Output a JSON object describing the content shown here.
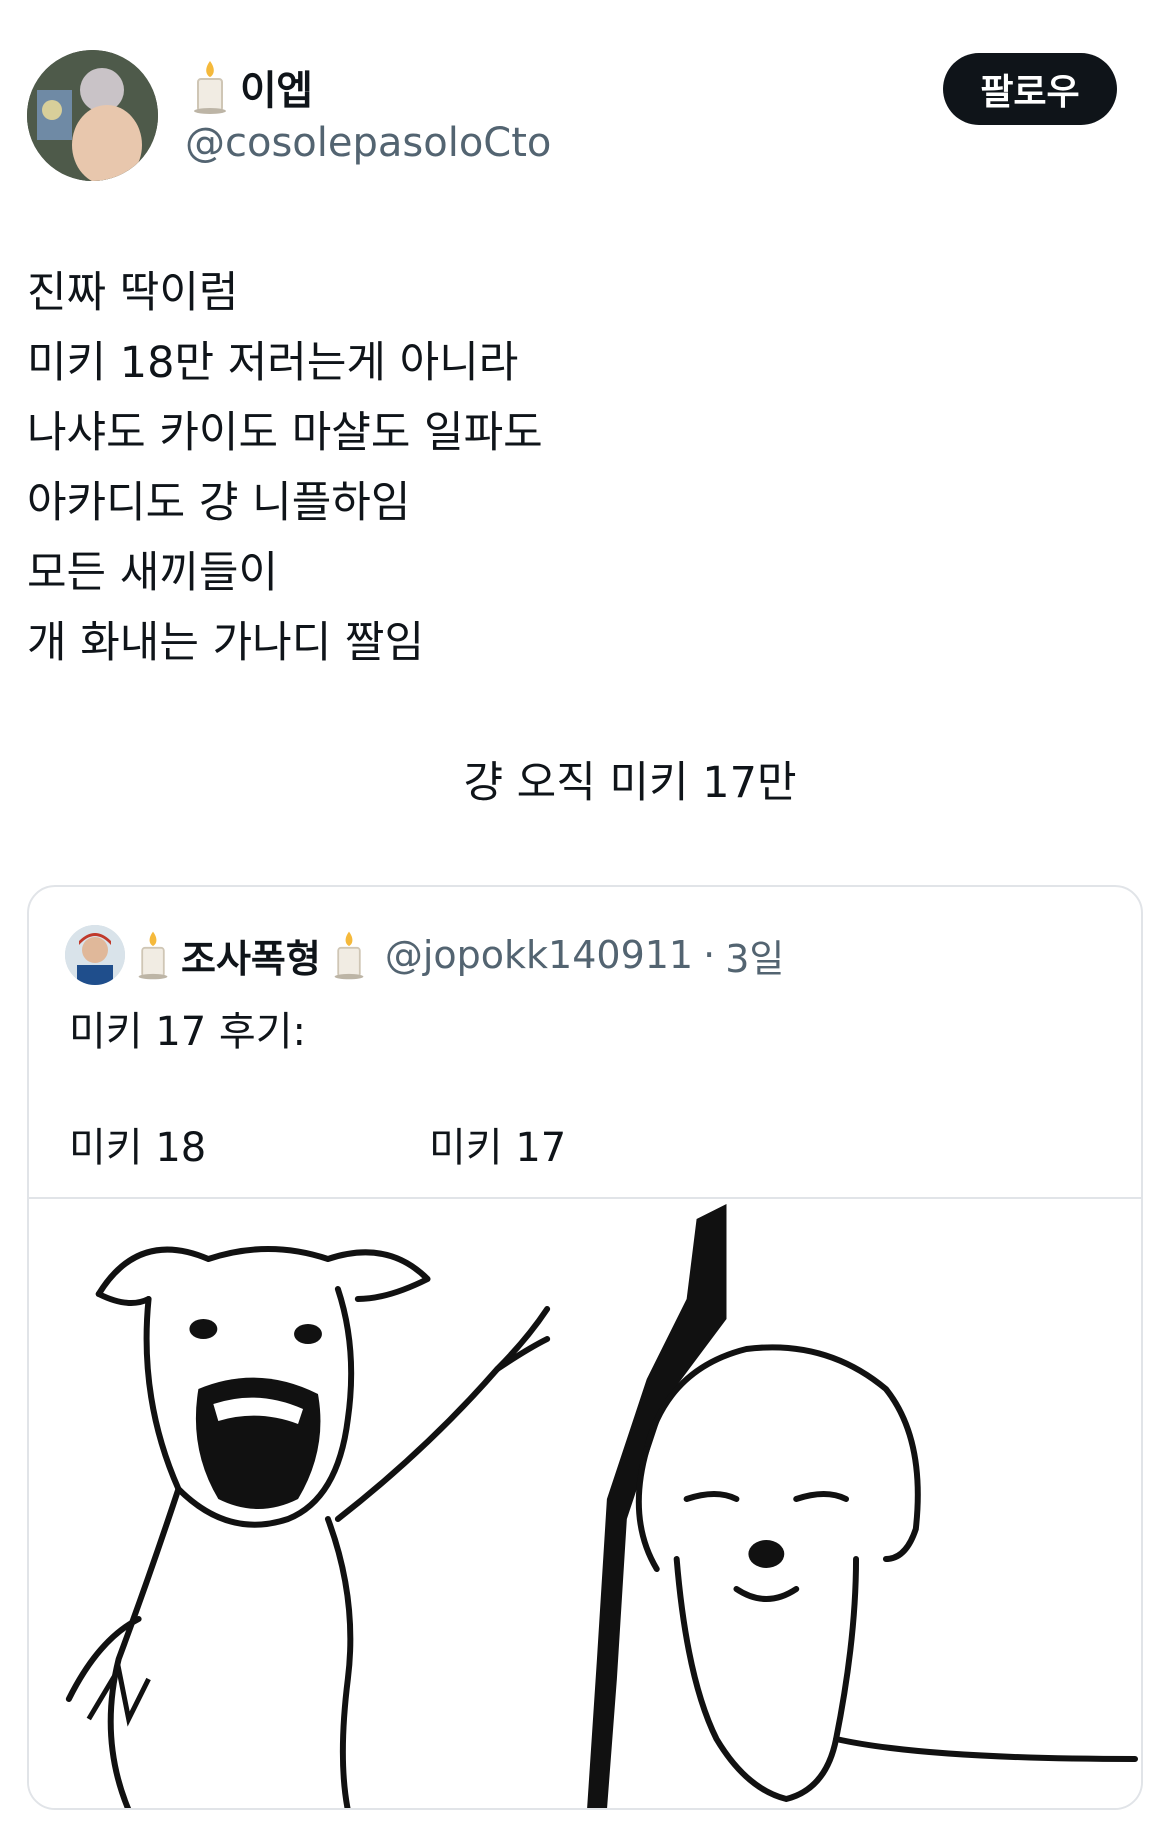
{
  "author": {
    "display_name": "이엡",
    "name_emoji_icon": "candle-icon",
    "handle": "@cosolepasoloCto",
    "follow_label": "팔로우"
  },
  "tweet": {
    "lines": [
      "진짜 딱이럼",
      "미키 18만 저러는게 아니라",
      "나샤도 카이도 마샬도 일파도",
      "아카디도 걍 니플하임",
      "모든 새끼들이",
      "개 화내는 가나디 짤임"
    ],
    "centered_line": "걍 오직 미키 17만"
  },
  "quote": {
    "display_name": "조사폭형",
    "name_emoji_icon": "candle-icon",
    "handle": "@jopokk140911",
    "separator": "·",
    "time": "3일",
    "text": "미키 17 후기:",
    "label_left": "미키 18",
    "label_right": "미키 17",
    "image_icon": "angry-dog-vs-sad-dog-meme"
  }
}
